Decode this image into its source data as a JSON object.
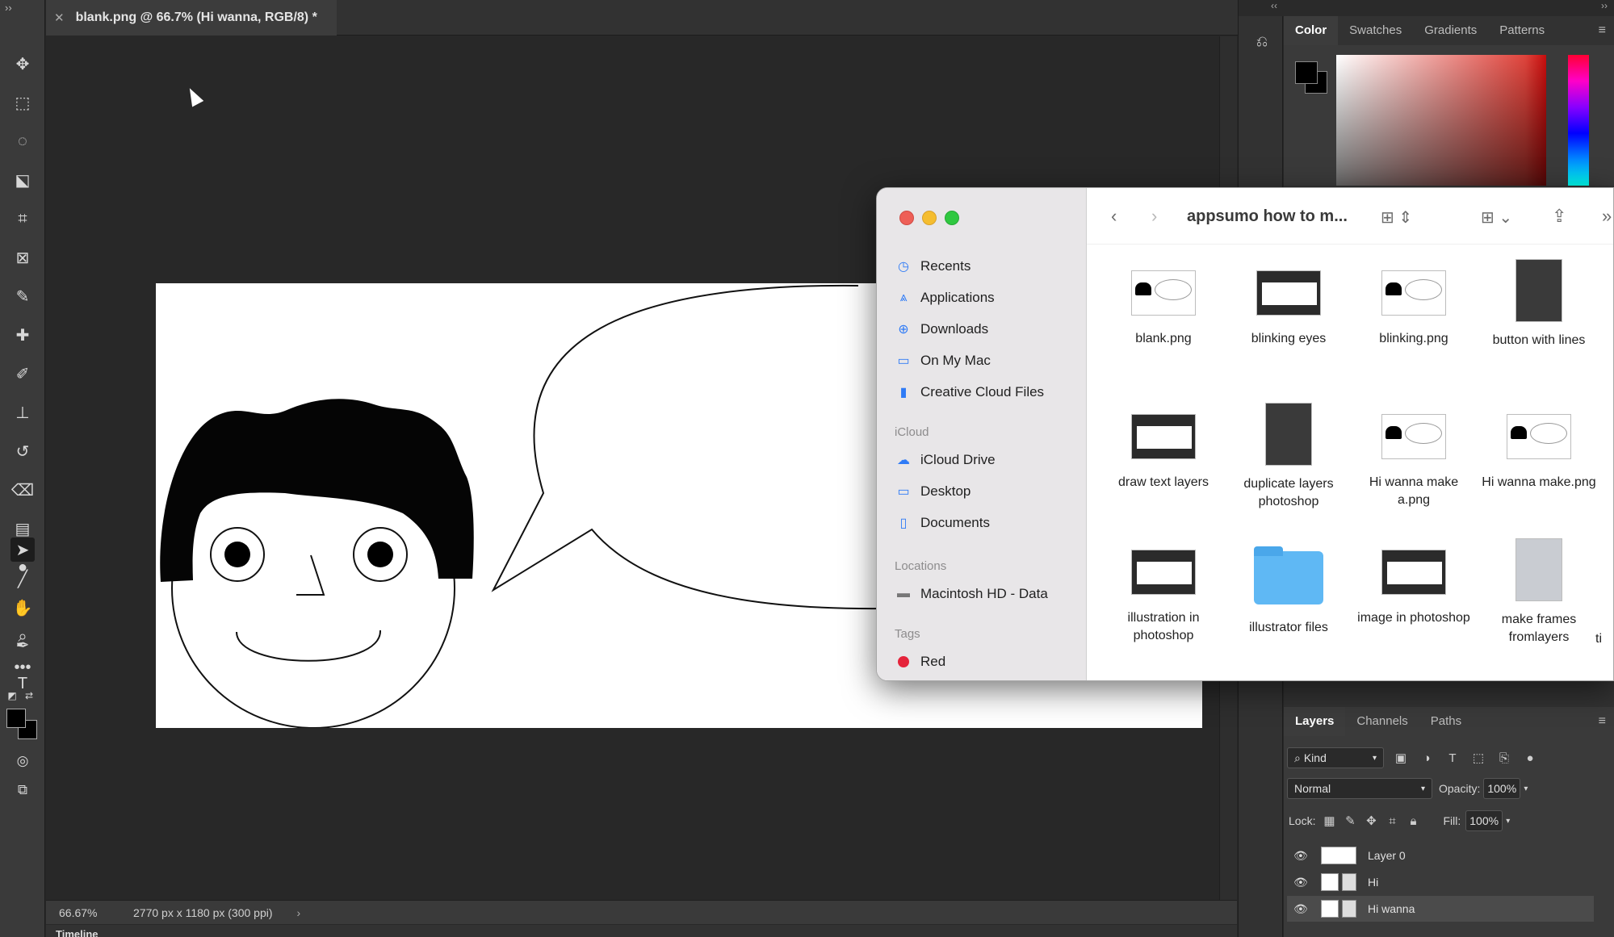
{
  "document": {
    "tab_title": "blank.png @ 66.7% (Hi wanna, RGB/8) *"
  },
  "status": {
    "zoom": "66.67%",
    "dimensions": "2770 px x 1180 px (300 ppi)",
    "timeline_label": "Timeline"
  },
  "color_panel": {
    "tabs": [
      "Color",
      "Swatches",
      "Gradients",
      "Patterns"
    ],
    "active_tab": "Color",
    "foreground": "#000000",
    "background": "#000000"
  },
  "layers_panel": {
    "tabs": [
      "Layers",
      "Channels",
      "Paths"
    ],
    "kind_filter": "Kind",
    "blend_mode": "Normal",
    "opacity_label": "Opacity:",
    "opacity": "100%",
    "lock_label": "Lock:",
    "fill_label": "Fill:",
    "fill": "100%",
    "layers": [
      {
        "name": "Layer 0",
        "selected": false
      },
      {
        "name": "Hi",
        "selected": false
      },
      {
        "name": "Hi wanna",
        "selected": true
      }
    ]
  },
  "finder": {
    "title": "appsumo how to m...",
    "favorites": [
      {
        "label": "Recents",
        "icon": "clock-icon"
      },
      {
        "label": "Applications",
        "icon": "applications-icon"
      },
      {
        "label": "Downloads",
        "icon": "download-icon"
      },
      {
        "label": "On My Mac",
        "icon": "folder-icon"
      },
      {
        "label": "Creative Cloud Files",
        "icon": "document-icon"
      }
    ],
    "icloud_heading": "iCloud",
    "icloud": [
      {
        "label": "iCloud Drive",
        "icon": "cloud-icon"
      },
      {
        "label": "Desktop",
        "icon": "desktop-icon"
      },
      {
        "label": "Documents",
        "icon": "document-icon"
      }
    ],
    "locations_heading": "Locations",
    "locations": [
      {
        "label": "Macintosh HD - Data",
        "icon": "disk-icon"
      }
    ],
    "tags_heading": "Tags",
    "tags": [
      {
        "label": "Red",
        "color": "#e5243b"
      }
    ],
    "files": [
      {
        "label": "blank.png",
        "kind": "face"
      },
      {
        "label": "blinking eyes",
        "kind": "face-dark"
      },
      {
        "label": "blinking.png",
        "kind": "face"
      },
      {
        "label": "button with lines",
        "kind": "screen-tall"
      },
      {
        "label": "draw text layers",
        "kind": "screen"
      },
      {
        "label": "duplicate layers photoshop",
        "kind": "screen-tall"
      },
      {
        "label": "Hi wanna make a.png",
        "kind": "face"
      },
      {
        "label": "Hi wanna make.png",
        "kind": "face"
      },
      {
        "label": "illustration in photoshop",
        "kind": "screen"
      },
      {
        "label": "illustrator files",
        "kind": "folder"
      },
      {
        "label": "image in photoshop",
        "kind": "screen"
      },
      {
        "label": "make frames fromlayers",
        "kind": "screen-tall-light"
      }
    ],
    "partial_item": "ti"
  }
}
